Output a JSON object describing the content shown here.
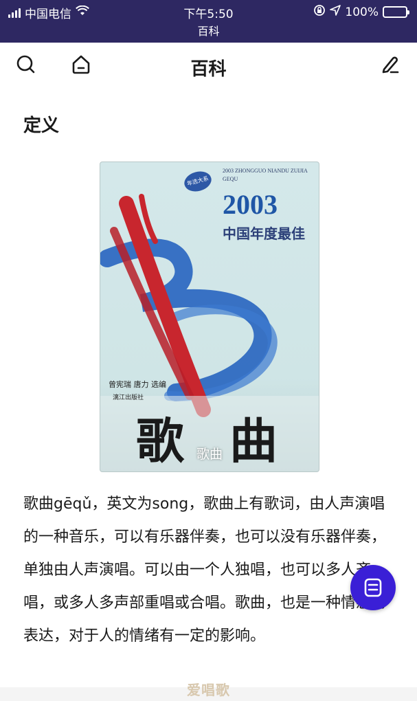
{
  "status_bar": {
    "carrier": "中国电信",
    "time": "下午5:50",
    "battery": "100%",
    "page_subtitle": "百科",
    "bar_color": "#2e2862"
  },
  "nav": {
    "title": "百科",
    "left_icons": [
      "search-icon",
      "home-icon"
    ],
    "right_icon": "edit-icon"
  },
  "section": {
    "title": "定义"
  },
  "cover": {
    "badge": "年选大系",
    "en_line1": "2003 ZHONGGUO NIANDU ZUIJIA",
    "en_line2": "GEQU",
    "year": "2003",
    "subtitle": "中国年度最佳",
    "editors": "曾宪瑞 唐力 选编",
    "publisher": "漓江出版社",
    "big_char_1": "歌",
    "big_char_2": "曲",
    "caption": "歌曲"
  },
  "content": {
    "paragraph": "歌曲gēqǔ，英文为song，歌曲上有歌词，由人声演唱的一种音乐，可以有乐器伴奏，也可以没有乐器伴奏，单独由人声演唱。可以由一个人独唱，也可以多人齐唱，或多人多声部重唱或合唱。歌曲，也是一种情感的表达，对于人的情绪有一定的影响。"
  },
  "fab": {
    "icon": "document-icon",
    "color": "#3a1fd6"
  },
  "watermark": "爱唱歌"
}
